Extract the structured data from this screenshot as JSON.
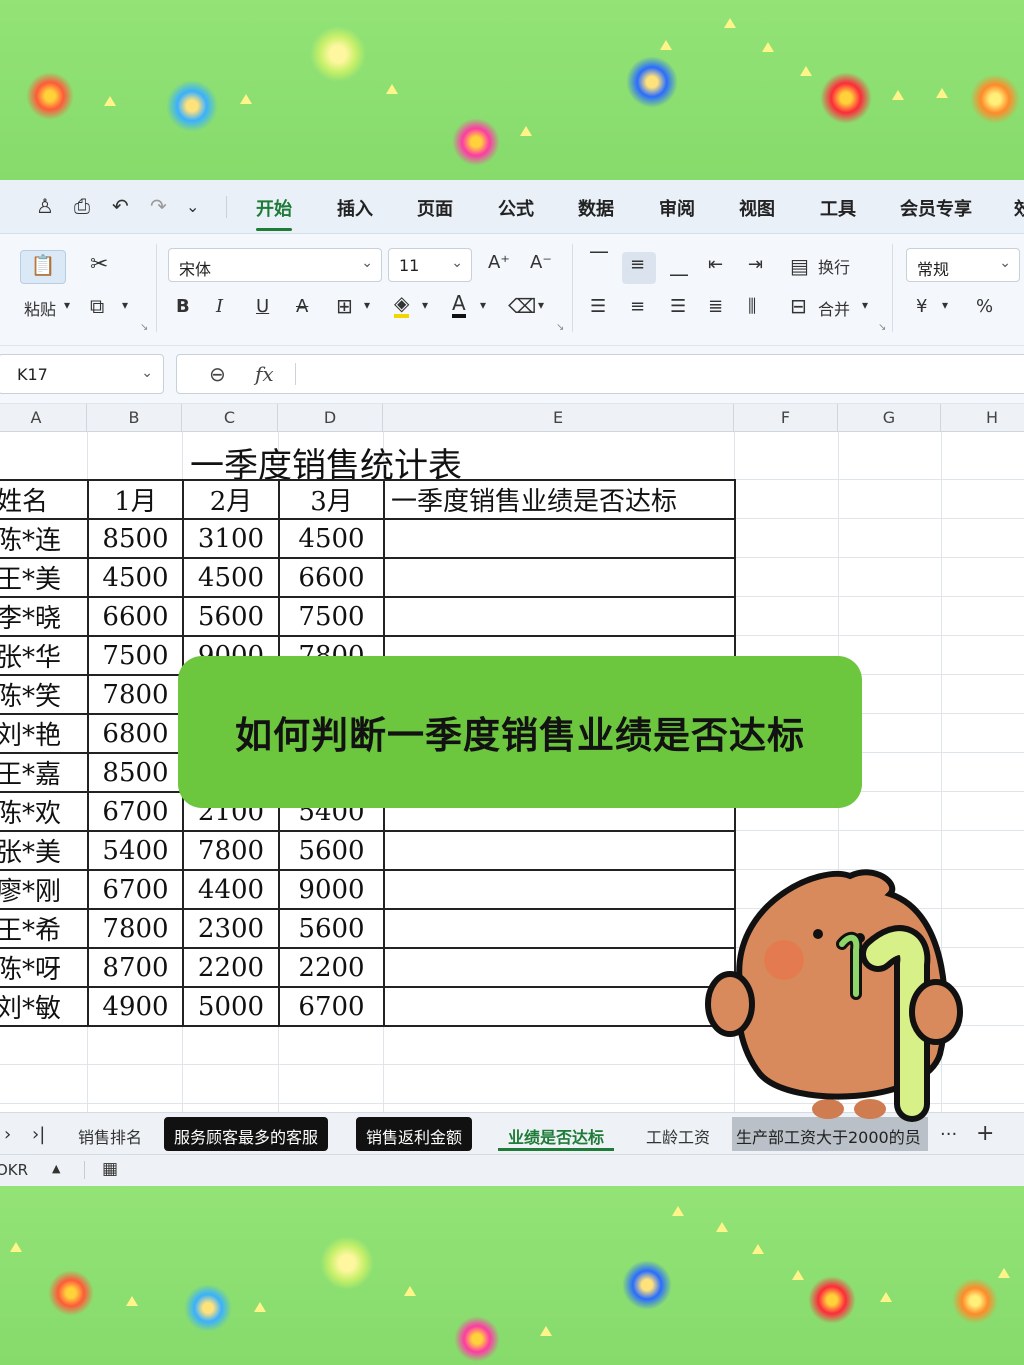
{
  "quick_access_icons": [
    "user-icon",
    "print-preview-icon",
    "undo-icon",
    "redo-icon",
    "more-icon"
  ],
  "menu_tabs": [
    "开始",
    "插入",
    "页面",
    "公式",
    "数据",
    "审阅",
    "视图",
    "工具",
    "会员专享"
  ],
  "menu_tab_partial": "效",
  "ribbon": {
    "paste_label": "粘贴",
    "font_name": "宋体",
    "font_size": "11",
    "bold": "B",
    "italic": "I",
    "underline": "U",
    "strike": "A",
    "wrap_label": "换行",
    "merge_label": "合并",
    "number_format": "常规",
    "currency": "¥",
    "percent": "%",
    "font_grow": "A⁺",
    "font_shrink": "A⁻"
  },
  "formula_bar": {
    "cell_ref": "K17",
    "fx": "fx",
    "value": ""
  },
  "column_headers": [
    "A",
    "B",
    "C",
    "D",
    "E",
    "F",
    "G",
    "H"
  ],
  "sheet": {
    "title": "一季度销售统计表",
    "headers": [
      "姓名",
      "1月",
      "2月",
      "3月",
      "一季度销售业绩是否达标"
    ],
    "rows": [
      {
        "name": "陈*连",
        "m1": "8500",
        "m2": "3100",
        "m3": "4500"
      },
      {
        "name": "王*美",
        "m1": "4500",
        "m2": "4500",
        "m3": "6600"
      },
      {
        "name": "李*晓",
        "m1": "6600",
        "m2": "5600",
        "m3": "7500"
      },
      {
        "name": "张*华",
        "m1": "7500",
        "m2": "9000",
        "m3": "7800"
      },
      {
        "name": "陈*笑",
        "m1": "7800",
        "m2": "",
        "m3": ""
      },
      {
        "name": "刘*艳",
        "m1": "6800",
        "m2": "",
        "m3": ""
      },
      {
        "name": "王*嘉",
        "m1": "8500",
        "m2": "",
        "m3": ""
      },
      {
        "name": "陈*欢",
        "m1": "6700",
        "m2": "2100",
        "m3": "5400"
      },
      {
        "name": "张*美",
        "m1": "5400",
        "m2": "7800",
        "m3": "5600"
      },
      {
        "name": "廖*刚",
        "m1": "6700",
        "m2": "4400",
        "m3": "9000"
      },
      {
        "name": "王*希",
        "m1": "7800",
        "m2": "2300",
        "m3": "5600"
      },
      {
        "name": "陈*呀",
        "m1": "8700",
        "m2": "2200",
        "m3": "2200"
      },
      {
        "name": "刘*敏",
        "m1": "4900",
        "m2": "5000",
        "m3": "6700"
      }
    ]
  },
  "sheet_tabs": [
    "销售排名",
    "服务顾客最多的客服",
    "销售返利金额",
    "业绩是否达标",
    "工龄工资",
    "生产部工资大于2000的员"
  ],
  "active_sheet_tab": "业绩是否达标",
  "tab_nav": {
    "next": "›",
    "last": "›|",
    "more": "···",
    "add": "+"
  },
  "status_bar": {
    "left": "OKR",
    "icon": "calendar-icon"
  },
  "caption": "如何判断一季度销售业绩是否达标",
  "mascot_number": "1",
  "colors": {
    "background": "#8fe073",
    "accent": "#1e7b38",
    "caption_bg": "#6cc63e",
    "ribbon_bg": "#f4f7fb",
    "mascot": "#d98a5c"
  }
}
